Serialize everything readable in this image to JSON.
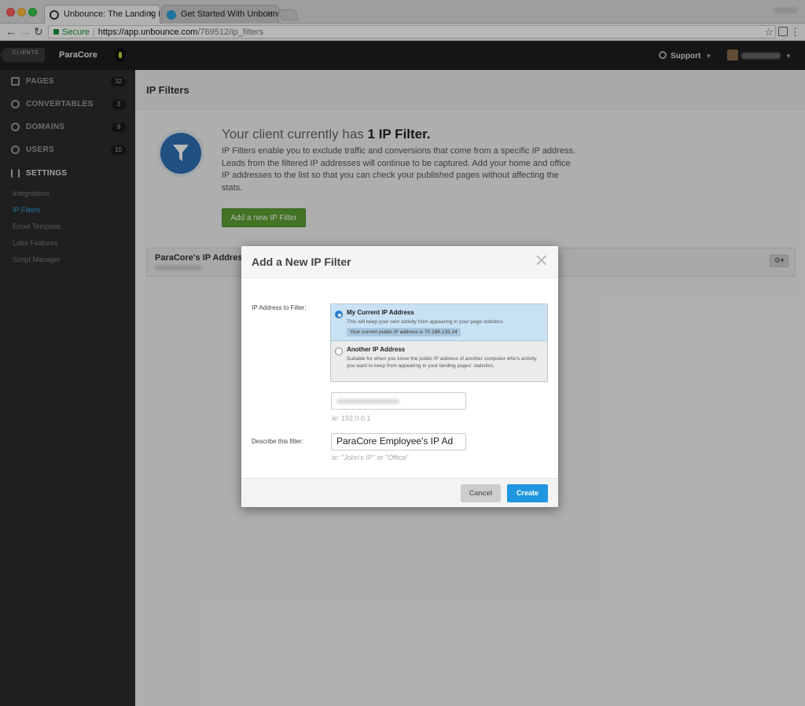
{
  "browser": {
    "tabs": [
      {
        "title": "Unbounce: The Landing Page B"
      },
      {
        "title": "Get Started With Unbounce"
      }
    ],
    "address": {
      "secure_label": "Secure",
      "url_host": "https://app.unbounce.com",
      "url_path": "/769512/ip_filters"
    }
  },
  "header": {
    "clients_label": "CLIENTS",
    "client_name": "ParaCore",
    "support_label": "Support"
  },
  "sidebar": {
    "items": [
      {
        "label": "PAGES",
        "count": "32",
        "icon": "pages-icon"
      },
      {
        "label": "CONVERTABLES",
        "count": "3",
        "icon": "convertables-icon"
      },
      {
        "label": "DOMAINS",
        "count": "9",
        "icon": "globe-icon"
      },
      {
        "label": "USERS",
        "count": "10",
        "icon": "users-icon"
      },
      {
        "label": "SETTINGS",
        "icon": "sliders-icon"
      }
    ],
    "settings_sub": [
      "Integrations",
      "IP Filters",
      "Email Template",
      "Labs Features",
      "Script Manager"
    ]
  },
  "main": {
    "page_title": "IP Filters",
    "hero_prefix": "Your client currently has ",
    "hero_bold": "1 IP Filter.",
    "hero_desc": "IP Filters enable you to exclude traffic and conversions that come from a specific IP address. Leads from the filtered IP addresses will continue to be captured. Add your home and office IP addresses to the list so that you can check your published pages without affecting the stats.",
    "add_button": "Add a new IP Filter",
    "filter_row_name": "ParaCore's IP Addres"
  },
  "modal": {
    "title": "Add a New IP Filter",
    "ip_label": "IP Address to Filter:",
    "option_current_title": "My Current IP Address",
    "option_current_desc": "This will keep your own activity from appearing in your page statistics",
    "option_current_ip": "Your current public IP address is 70.186.133.24",
    "option_other_title": "Another IP Address",
    "option_other_desc": "Suitable for when you know the public IP address of another computer who's activity you want to keep from appearing in your landing pages' statistics.",
    "ip_hint": "ie: 192.0.0.1",
    "describe_label": "Describe this filter:",
    "describe_value": "ParaCore Employee's IP Ad",
    "describe_hint": "ie: \"John's IP\" or \"Office\"",
    "cancel_label": "Cancel",
    "create_label": "Create"
  },
  "colors": {
    "accent_blue": "#1f96e0",
    "add_green": "#5da034",
    "badge_blue": "#2f6fb5"
  }
}
